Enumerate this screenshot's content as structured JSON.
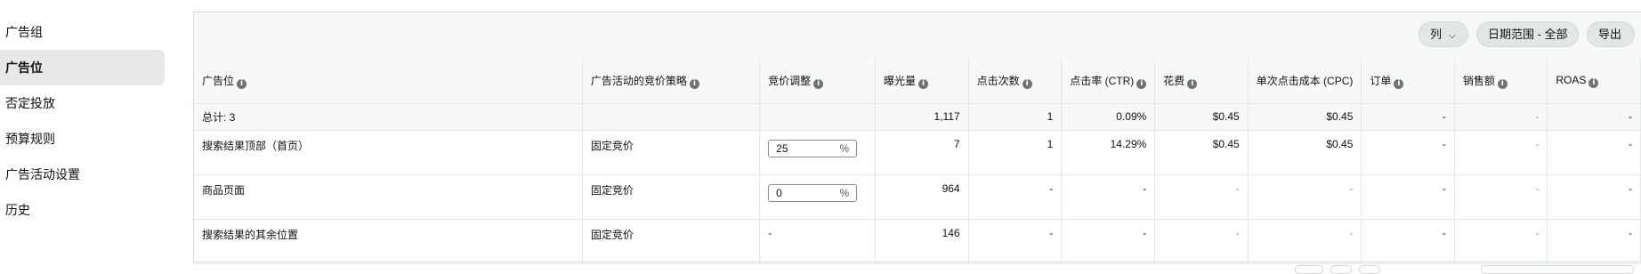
{
  "sidebar": {
    "items": [
      {
        "label": "广告组",
        "active": false
      },
      {
        "label": "广告位",
        "active": true
      },
      {
        "label": "否定投放",
        "active": false
      },
      {
        "label": "预算规则",
        "active": false
      },
      {
        "label": "广告活动设置",
        "active": false
      },
      {
        "label": "历史",
        "active": false
      }
    ]
  },
  "toolbar": {
    "columns_label": "列",
    "date_range_label": "日期范围 - 全部",
    "export_label": "导出"
  },
  "table": {
    "headers": [
      "广告位",
      "广告活动的竞价策略",
      "竞价调整",
      "曝光量",
      "点击次数",
      "点击率 (CTR)",
      "花费",
      "单次点击成本 (CPC)",
      "订单",
      "销售额",
      "ROAS"
    ],
    "total": [
      "总计: 3",
      "",
      "",
      "1,117",
      "1",
      "0.09%",
      "$0.45",
      "$0.45",
      "-",
      "-",
      "-"
    ],
    "rows": [
      {
        "placement": "搜索结果顶部（首页）",
        "strategy": "固定竞价",
        "bid_value": "25",
        "bid_unit": "%",
        "impressions": "7",
        "clicks": "1",
        "ctr": "14.29%",
        "spend": "$0.45",
        "cpc": "$0.45",
        "orders": "-",
        "sales": "-",
        "roas": "-"
      },
      {
        "placement": "商品页面",
        "strategy": "固定竞价",
        "bid_value": "0",
        "bid_unit": "%",
        "impressions": "964",
        "clicks": "-",
        "ctr": "-",
        "spend": "-",
        "cpc": "-",
        "orders": "-",
        "sales": "-",
        "roas": "-"
      },
      {
        "placement": "搜索结果的其余位置",
        "strategy": "固定竞价",
        "bid_text": "-",
        "impressions": "146",
        "clicks": "-",
        "ctr": "-",
        "spend": "-",
        "cpc": "-",
        "orders": "-",
        "sales": "-",
        "roas": "-"
      }
    ]
  }
}
